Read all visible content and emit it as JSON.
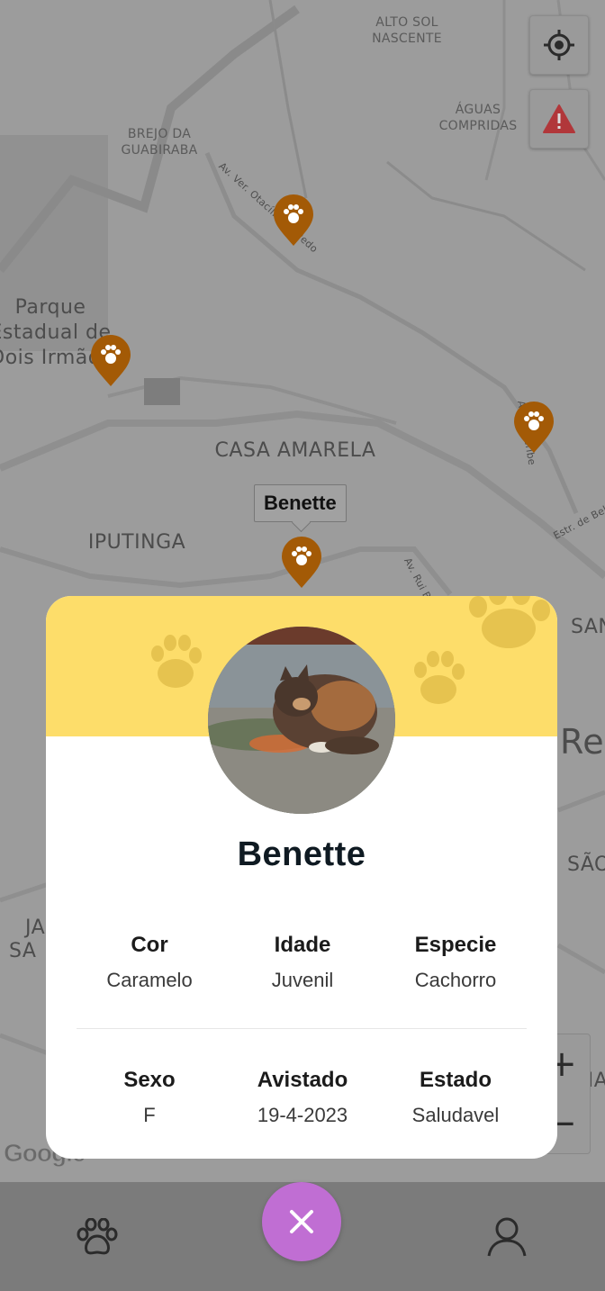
{
  "map": {
    "labels": {
      "alto_sol_nascente": "ALTO SOL\nNASCENTE",
      "aguas_compridas": "ÁGUAS\nCOMPRIDAS",
      "brejo": "BREJO DA\nGUABIRABA",
      "parque": "Parque\nEstadual de\nDois Irmãos",
      "casa_amarela": "CASA AMARELA",
      "iputinga": "IPUTINGA",
      "av_otacilio": "Av. Ver. Otacílio Azevedo",
      "av_beberibe": "Av. Beberibe",
      "av_rui": "Av. Rui B",
      "estr_bel": "Estr. de Bel",
      "san": "SAN",
      "re": "Re",
      "sao": "SÃO",
      "pina": "PINA",
      "ja": "JA",
      "sa": "SA"
    },
    "tooltip": "Benette",
    "google_logo": "Google",
    "zoom_in": "+",
    "zoom_out": "−"
  },
  "pet": {
    "name": "Benette",
    "fields": [
      {
        "label": "Cor",
        "value": "Caramelo"
      },
      {
        "label": "Idade",
        "value": "Juvenil"
      },
      {
        "label": "Especie",
        "value": "Cachorro"
      },
      {
        "label": "Sexo",
        "value": "F"
      },
      {
        "label": "Avistado",
        "value": "19-4-2023"
      },
      {
        "label": "Estado",
        "value": "Saludavel"
      }
    ]
  },
  "icons": {
    "locate": "crosshair-icon",
    "alert": "warning-icon",
    "pin": "paw-pin-icon",
    "nav_left": "paw-icon",
    "nav_right": "user-icon",
    "close": "close-icon"
  },
  "colors": {
    "pin": "#a35a06",
    "modal_header": "#fddd6a",
    "fab": "#c06ed3",
    "alert": "#b1373a"
  }
}
